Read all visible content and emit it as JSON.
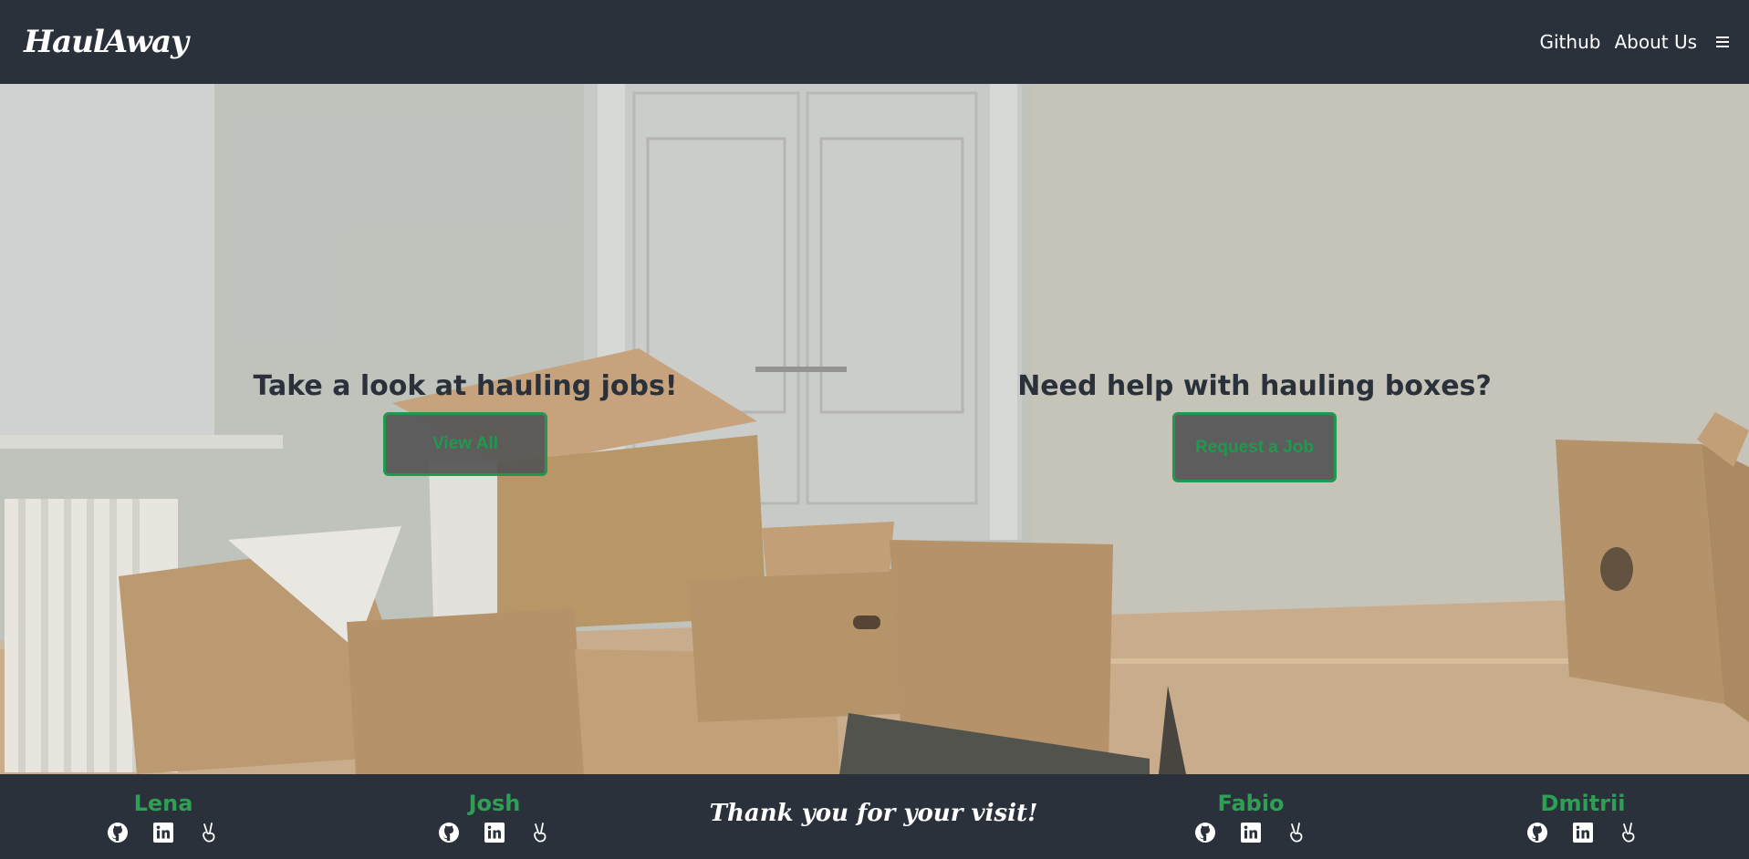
{
  "header": {
    "logo_text": "HaulAway",
    "nav": {
      "github_label": "Github",
      "about_label": "About Us"
    },
    "menu_icon": "hamburger-menu-icon"
  },
  "hero": {
    "left": {
      "heading": "Take a look at hauling jobs!",
      "button_label": "View All"
    },
    "right": {
      "heading": "Need help with hauling boxes?",
      "button_label": "Request a Job"
    }
  },
  "footer": {
    "thanks_text": "Thank you for your visit!",
    "members": [
      {
        "name": "Lena",
        "icons": [
          "github-icon",
          "linkedin-icon",
          "peace-hand-icon"
        ]
      },
      {
        "name": "Josh",
        "icons": [
          "github-icon",
          "linkedin-icon",
          "peace-hand-icon"
        ]
      },
      {
        "name": "Fabio",
        "icons": [
          "github-icon",
          "linkedin-icon",
          "peace-hand-icon"
        ]
      },
      {
        "name": "Dmitrii",
        "icons": [
          "github-icon",
          "linkedin-icon",
          "peace-hand-icon"
        ]
      }
    ]
  },
  "colors": {
    "header_bg": "#2a313b",
    "accent_green": "#1e9a4e",
    "heading_text": "#2a313b",
    "button_bg": "#555555"
  }
}
